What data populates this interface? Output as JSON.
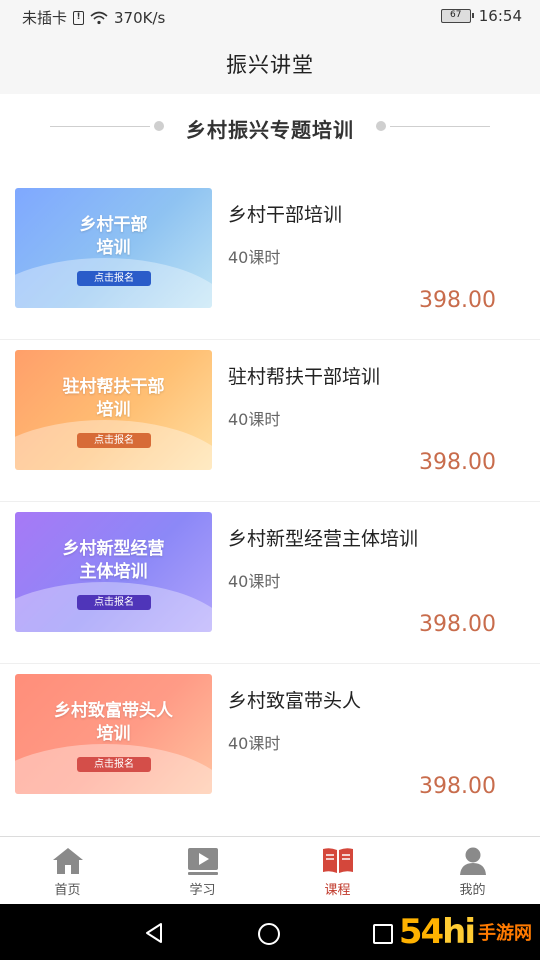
{
  "status_bar": {
    "carrier": "未插卡",
    "sim_icon": "!",
    "speed": "370K/s",
    "battery": "67",
    "time": "16:54"
  },
  "header": {
    "title": "振兴讲堂"
  },
  "section": {
    "title": "乡村振兴专题培训"
  },
  "courses": [
    {
      "name": "乡村干部培训",
      "hours": "40课时",
      "price": "398.00",
      "thumb_title": "乡村干部\n培训",
      "thumb_button": "点击报名"
    },
    {
      "name": "驻村帮扶干部培训",
      "hours": "40课时",
      "price": "398.00",
      "thumb_title": "驻村帮扶干部\n培训",
      "thumb_button": "点击报名"
    },
    {
      "name": "乡村新型经营主体培训",
      "hours": "40课时",
      "price": "398.00",
      "thumb_title": "乡村新型经营\n主体培训",
      "thumb_button": "点击报名"
    },
    {
      "name": "乡村致富带头人",
      "hours": "40课时",
      "price": "398.00",
      "thumb_title": "乡村致富带头人\n培训",
      "thumb_button": "点击报名"
    }
  ],
  "tabs": [
    {
      "label": "首页",
      "icon": "home-icon"
    },
    {
      "label": "学习",
      "icon": "play-icon"
    },
    {
      "label": "课程",
      "icon": "book-icon",
      "active": true
    },
    {
      "label": "我的",
      "icon": "user-icon"
    }
  ],
  "watermark": {
    "number": "54",
    "letters": "hi",
    "text": "手游网"
  },
  "colors": {
    "price": "#c86c4c",
    "active_tab": "#c0392b"
  }
}
